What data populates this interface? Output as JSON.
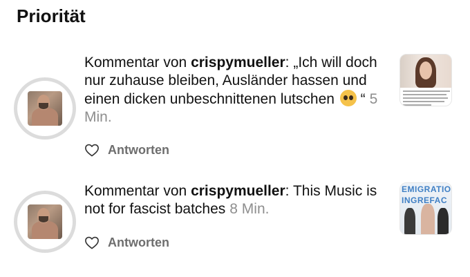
{
  "section": {
    "title": "Priorität"
  },
  "notifications": [
    {
      "prefix": "Kommentar von ",
      "username": "crispymueller",
      "comment_before_emoji": ": „Ich will doch nur zuhause bleiben, Ausländer hassen und einen dicken unbeschnittenen lutschen ",
      "emoji": "pleading-face-emoji",
      "comment_after_emoji": " “",
      "time": "5 Min.",
      "reply_label": "Antworten",
      "heart_icon": "heart-outline-icon"
    },
    {
      "prefix": "Kommentar von ",
      "username": "crispymueller",
      "comment": ": This Music is not for fascist batches",
      "time": "8 Min.",
      "reply_label": "Antworten",
      "heart_icon": "heart-outline-icon",
      "thumbnail_text": [
        "EMIGRATIO",
        "INGREFAC"
      ]
    }
  ],
  "colors": {
    "text": "#111111",
    "muted": "#8e8e8e",
    "reply": "#6e6e6e",
    "ring": "#dcdcdc",
    "thumbnail_accent": "#3f7fc4"
  }
}
